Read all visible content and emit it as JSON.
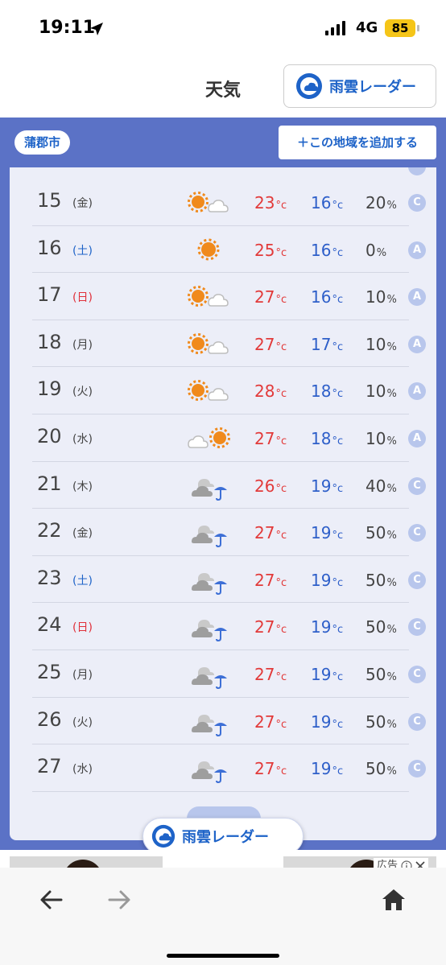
{
  "status_bar": {
    "time": "19:11",
    "network": "4G",
    "battery": "85"
  },
  "header": {
    "title": "天気",
    "radar_button": "雨雲レーダー"
  },
  "location": {
    "city": "蒲郡市",
    "add_button": "＋この地域を追加する"
  },
  "units": {
    "temp": "°c",
    "pop": "%"
  },
  "forecast": [
    {
      "day": "15",
      "weekday": "(金)",
      "weather": "sun-cloud",
      "high": "23",
      "low": "16",
      "pop": "20",
      "grade": "C"
    },
    {
      "day": "16",
      "weekday": "(土)",
      "weather": "sun",
      "high": "25",
      "low": "16",
      "pop": "0",
      "grade": "A"
    },
    {
      "day": "17",
      "weekday": "(日)",
      "weather": "sun-cloud",
      "high": "27",
      "low": "16",
      "pop": "10",
      "grade": "A"
    },
    {
      "day": "18",
      "weekday": "(月)",
      "weather": "sun-cloud",
      "high": "27",
      "low": "17",
      "pop": "10",
      "grade": "A"
    },
    {
      "day": "19",
      "weekday": "(火)",
      "weather": "sun-cloud",
      "high": "28",
      "low": "18",
      "pop": "10",
      "grade": "A"
    },
    {
      "day": "20",
      "weekday": "(水)",
      "weather": "cloud-sun",
      "high": "27",
      "low": "18",
      "pop": "10",
      "grade": "A"
    },
    {
      "day": "21",
      "weekday": "(木)",
      "weather": "cloud-rain",
      "high": "26",
      "low": "19",
      "pop": "40",
      "grade": "C"
    },
    {
      "day": "22",
      "weekday": "(金)",
      "weather": "cloud-rain",
      "high": "27",
      "low": "19",
      "pop": "50",
      "grade": "C"
    },
    {
      "day": "23",
      "weekday": "(土)",
      "weather": "cloud-rain",
      "high": "27",
      "low": "19",
      "pop": "50",
      "grade": "C"
    },
    {
      "day": "24",
      "weekday": "(日)",
      "weather": "cloud-rain",
      "high": "27",
      "low": "19",
      "pop": "50",
      "grade": "C"
    },
    {
      "day": "25",
      "weekday": "(月)",
      "weather": "cloud-rain",
      "high": "27",
      "low": "19",
      "pop": "50",
      "grade": "C"
    },
    {
      "day": "26",
      "weekday": "(火)",
      "weather": "cloud-rain",
      "high": "27",
      "low": "19",
      "pop": "50",
      "grade": "C"
    },
    {
      "day": "27",
      "weekday": "(水)",
      "weather": "cloud-rain",
      "high": "27",
      "low": "19",
      "pop": "50",
      "grade": "C"
    }
  ],
  "floating_radar_button": "雨雲レーダー",
  "ad": {
    "label": "広告"
  },
  "colors": {
    "accent": "#1e63c8",
    "panel": "#5b72c6",
    "high_temp": "#e23a3a",
    "low_temp": "#2e5fc9",
    "sun": "#f08a1c"
  }
}
